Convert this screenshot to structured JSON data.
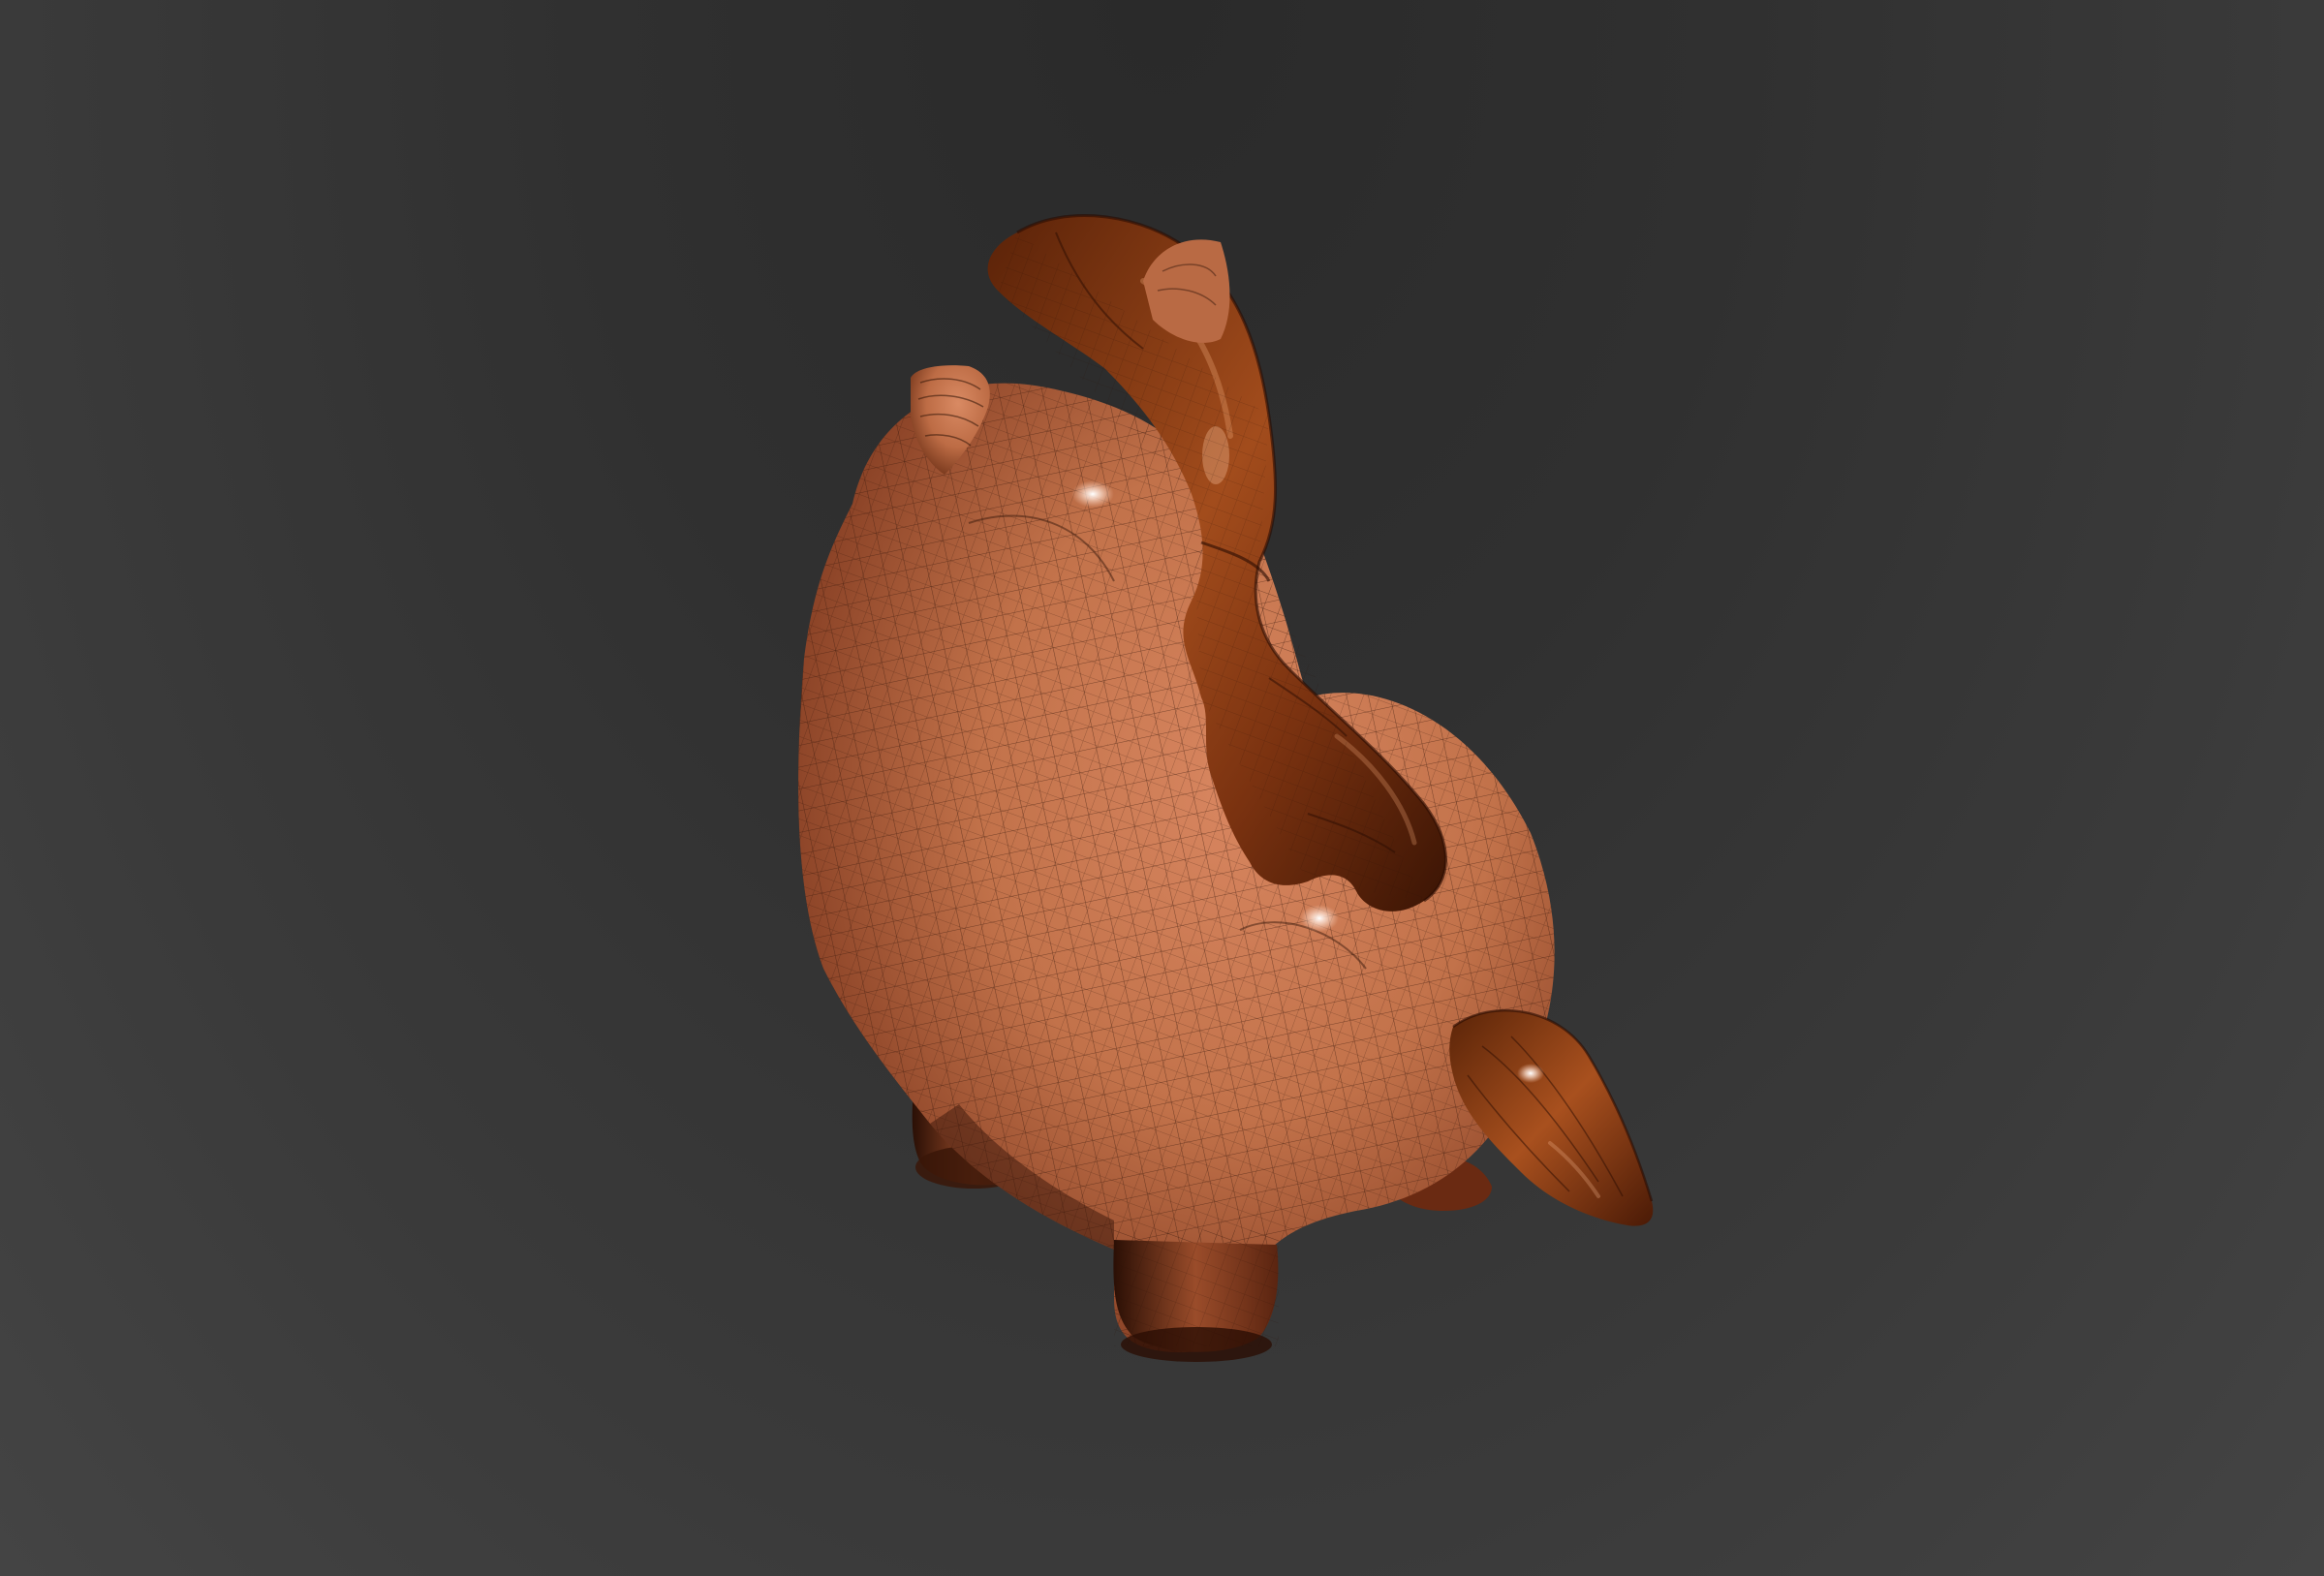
{
  "viewport": {
    "background_top": "#2a2a2a",
    "background_bottom": "#444444"
  },
  "model": {
    "subject": "horse",
    "body_color": "#c2724a",
    "body_shadow": "#5a2a14",
    "mane_color": "#8a3a10",
    "mane_highlight": "#c8693a",
    "wire_color": "#3a1a0c",
    "display_mode": "shaded-with-wireframe"
  }
}
